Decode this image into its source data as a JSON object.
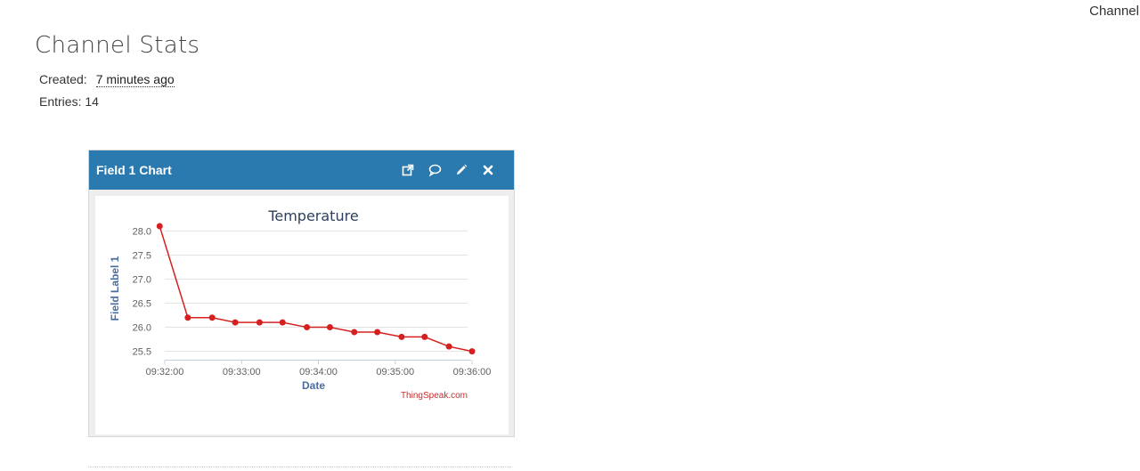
{
  "top_link": "Channel",
  "page_title": "Channel Stats",
  "stats": {
    "created_label": "Created:",
    "created_value": "7 minutes ago",
    "entries_text": "Entries: 14"
  },
  "widget": {
    "title": "Field 1 Chart",
    "icons": [
      "external-link-icon",
      "comment-icon",
      "pencil-icon",
      "close-icon"
    ]
  },
  "chart_data": {
    "type": "line",
    "title": "Temperature",
    "xlabel": "Date",
    "ylabel": "Field Label 1",
    "credit": "ThingSpeak.com",
    "ylim": [
      25.4,
      28.1
    ],
    "yticks": [
      25.5,
      26.0,
      26.5,
      27.0,
      27.5,
      28.0
    ],
    "ytick_labels": [
      "25.5",
      "26.0",
      "26.5",
      "27.0",
      "27.5",
      "28.0"
    ],
    "xlim": [
      "09:32:00",
      "09:36:00"
    ],
    "xticks": [
      "09:32:00",
      "09:33:00",
      "09:34:00",
      "09:35:00",
      "09:36:00"
    ],
    "grid": true,
    "line_color": "#d62020",
    "series": [
      {
        "x": [
          "09:31:56",
          "09:32:18",
          "09:32:37",
          "09:32:55",
          "09:33:14",
          "09:33:32",
          "09:33:51",
          "09:34:09",
          "09:34:28",
          "09:34:46",
          "09:35:05",
          "09:35:23",
          "09:35:42",
          "09:36:00"
        ],
        "y": [
          28.1,
          26.2,
          26.2,
          26.1,
          26.1,
          26.1,
          26.0,
          26.0,
          25.9,
          25.9,
          25.8,
          25.8,
          25.6,
          25.5
        ]
      }
    ]
  }
}
